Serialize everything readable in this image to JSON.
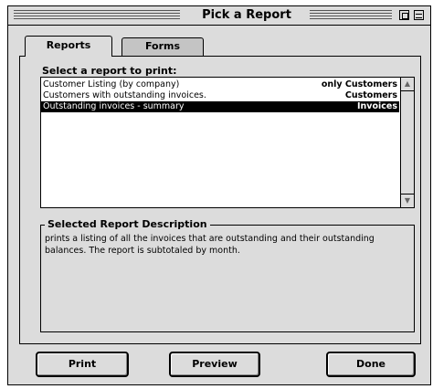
{
  "window": {
    "title": "Pick a Report"
  },
  "tabs": [
    {
      "label": "Reports",
      "active": true
    },
    {
      "label": "Forms",
      "active": false
    }
  ],
  "list_label": "Select a report to print:",
  "reports": [
    {
      "name": "Customer Listing (by company)",
      "category": "only Customers",
      "selected": false
    },
    {
      "name": "Customers with outstanding invoices.",
      "category": "Customers",
      "selected": false
    },
    {
      "name": "Outstanding invoices - summary",
      "category": "Invoices",
      "selected": true
    }
  ],
  "description": {
    "title": "Selected Report Description",
    "text": "prints a listing of all the invoices that are outstanding and their outstanding balances. The report is subtotaled by month."
  },
  "buttons": {
    "print": "Print",
    "preview": "Preview",
    "done": "Done"
  },
  "icons": {
    "scroll_up": "scroll-up-arrow-icon",
    "scroll_down": "scroll-down-arrow-icon",
    "zoom": "zoom-box-icon",
    "windowshade": "windowshade-box-icon"
  }
}
